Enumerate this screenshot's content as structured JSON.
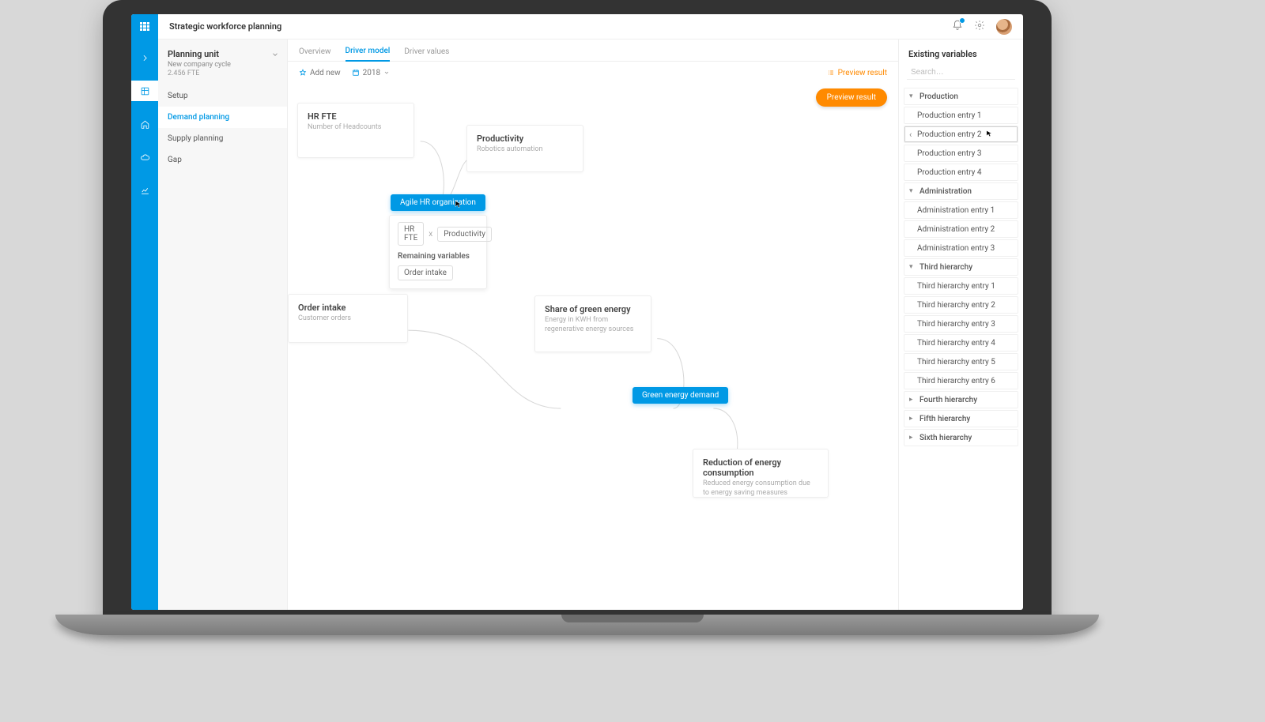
{
  "header": {
    "title": "Strategic workforce planning"
  },
  "leftpanel": {
    "planning_unit_label": "Planning unit",
    "cycle": "New company cycle",
    "fte": "2.456 FTE",
    "items": [
      {
        "label": "Setup"
      },
      {
        "label": "Demand planning"
      },
      {
        "label": "Supply planning"
      },
      {
        "label": "Gap"
      }
    ]
  },
  "tabs": [
    {
      "label": "Overview"
    },
    {
      "label": "Driver model"
    },
    {
      "label": "Driver values"
    }
  ],
  "toolbar": {
    "add_new": "Add new",
    "year": "2018",
    "preview_link": "Preview result",
    "preview_button": "Preview result"
  },
  "nodes": {
    "hr_fte": {
      "title": "HR FTE",
      "sub": "Number of Headcounts"
    },
    "productivity": {
      "title": "Productivity",
      "sub": "Robotics automation"
    },
    "order_intake": {
      "title": "Order intake",
      "sub": "Customer orders"
    },
    "green_share": {
      "title": "Share of green energy",
      "sub": "Energy in KWH from regenerative energy sources"
    },
    "reduction": {
      "title": "Reduction of energy consumption",
      "sub": "Reduced energy consumption due to energy saving measures"
    }
  },
  "chips": {
    "agile": "Agile HR organization",
    "green_demand": "Green energy demand"
  },
  "formula": {
    "a": "HR FTE",
    "op": "x",
    "b": "Productivity",
    "remaining_label": "Remaining variables",
    "remaining": "Order intake"
  },
  "rightpanel": {
    "title": "Existing variables",
    "search_placeholder": "Search…",
    "groups": [
      {
        "name": "Production",
        "expanded": true,
        "children": [
          "Production entry 1",
          "Production entry 2",
          "Production entry 3",
          "Production entry 4"
        ]
      },
      {
        "name": "Administration",
        "expanded": true,
        "children": [
          "Administration entry 1",
          "Administration entry 2",
          "Administration entry 3"
        ]
      },
      {
        "name": "Third hierarchy",
        "expanded": true,
        "children": [
          "Third hierarchy entry 1",
          "Third hierarchy entry 2",
          "Third hierarchy entry 3",
          "Third hierarchy entry 4",
          "Third hierarchy entry 5",
          "Third hierarchy entry 6"
        ]
      },
      {
        "name": "Fourth hierarchy",
        "expanded": false,
        "children": []
      },
      {
        "name": "Fifth hierarchy",
        "expanded": false,
        "children": []
      },
      {
        "name": "Sixth hierarchy",
        "expanded": false,
        "children": []
      }
    ]
  }
}
